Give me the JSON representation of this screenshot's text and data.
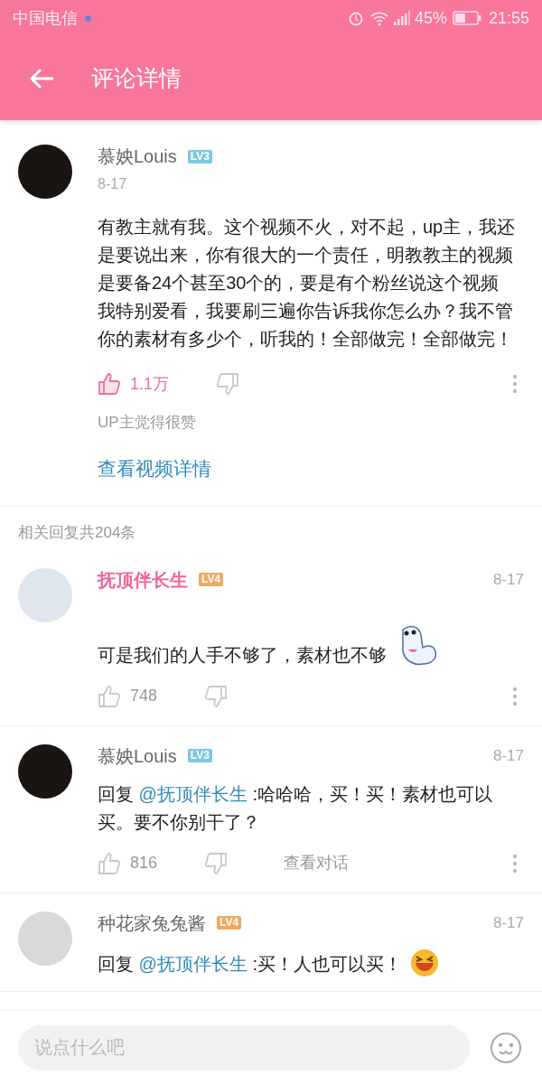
{
  "status_bar": {
    "carrier": "中国电信",
    "battery": "45%",
    "time": "21:55"
  },
  "header": {
    "title": "评论详情"
  },
  "main_comment": {
    "user": "慕姎Louis",
    "level": "LV3",
    "color": "#7ec8e3",
    "date": "8-17",
    "text": "有教主就有我。这个视频不火，对不起，up主，我还是要说出来，你有很大的一个责任，明教教主的视频是要备24个甚至30个的，要是有个粉丝说这个视频我特别爱看，我要刷三遍你告诉我你怎么办？我不管你的素材有多少个，听我的！全部做完！全部做完！",
    "likes": "1.1万",
    "liked": true,
    "up_note": "UP主觉得很赞",
    "link": "查看视频详情"
  },
  "replies_header": "相关回复共204条",
  "replies": [
    {
      "kind": "ghost",
      "user": "抚顶伴长生",
      "vip": true,
      "level": "LV4",
      "color": "#f0a860",
      "date": "8-17",
      "text": "可是我们的人手不够了，素材也不够",
      "likes": "748",
      "liked": false
    },
    {
      "kind": "plain",
      "user": "慕姎Louis",
      "vip": false,
      "level": "LV3",
      "color": "#7ec8e3",
      "date": "8-17",
      "prefix": "回复",
      "mention": "@抚顶伴长生",
      "text": ":哈哈哈，买！买！素材也可以买。要不你别干了？",
      "likes": "816",
      "liked": false,
      "conversation": "查看对话"
    },
    {
      "kind": "laugh",
      "user": "种花家兔兔酱",
      "vip": false,
      "level": "LV4",
      "color": "#f0a860",
      "date": "8-17",
      "prefix": "回复",
      "mention": "@抚顶伴长生",
      "text": ":买！人也可以买！"
    }
  ],
  "input": {
    "placeholder": "说点什么吧"
  }
}
